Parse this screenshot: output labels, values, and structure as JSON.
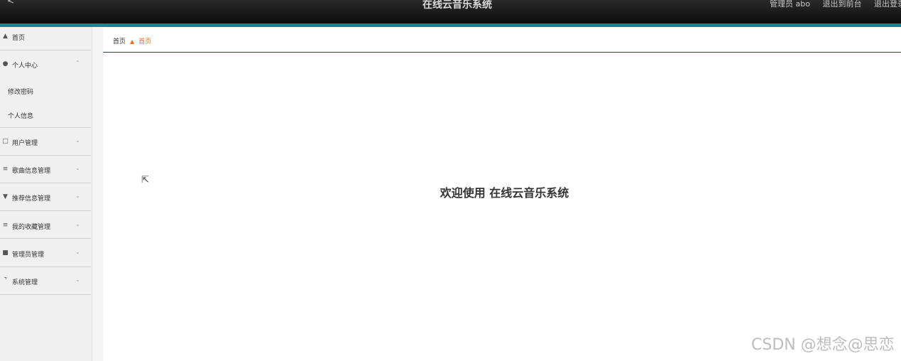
{
  "header": {
    "back_glyph": "<",
    "title": "在线云音乐系统",
    "user_label": "管理员 abo",
    "to_front_label": "退出到前台",
    "logout_label": "退出登录"
  },
  "sidebar": {
    "home": {
      "icon": "home-icon",
      "label": "首页"
    },
    "personal_center": {
      "icon": "user-icon",
      "label": "个人中心",
      "expanded": true,
      "children": [
        "修改密码",
        "个人信息"
      ]
    },
    "items": [
      {
        "icon": "expand-icon",
        "label": "用户管理"
      },
      {
        "icon": "list-icon",
        "label": "歌曲信息管理"
      },
      {
        "icon": "recommend-icon",
        "label": "推荐信息管理"
      },
      {
        "icon": "sliders-icon",
        "label": "我的收藏管理"
      },
      {
        "icon": "checkbox-icon",
        "label": "管理员管理"
      },
      {
        "icon": "crop-icon",
        "label": "系统管理"
      }
    ]
  },
  "breadcrumb": {
    "home": "首页",
    "separator_icon": "home-icon",
    "current": "首页"
  },
  "main": {
    "welcome_text": "欢迎使用 在线云音乐系统"
  },
  "watermark": "CSDN @想念@思恋",
  "colors": {
    "header_bg": "#151515",
    "accent_teal": "#138a8a",
    "breadcrumb_active": "#e07020",
    "sidebar_bg": "#f0f0f0"
  }
}
